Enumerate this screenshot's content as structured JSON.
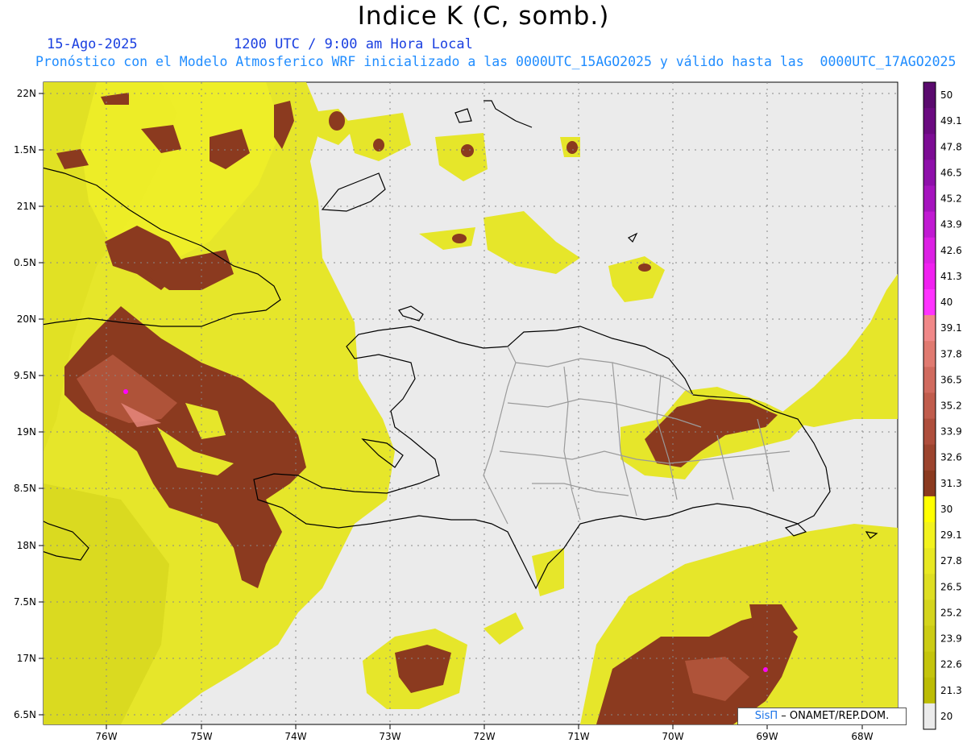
{
  "title": "Indice K (C, somb.)",
  "date_line": "15-Ago-2025",
  "time_line": "1200 UTC / 9:00 am Hora Local",
  "forecast_line": "Pronóstico con el Modelo Atmosferico WRF inicializado a las 0000UTC_15AGO2025 y válido hasta las  0000UTC_17AGO2025",
  "colors": {
    "date_text": "#1a3fe0",
    "forecast_text": "#1f8cff",
    "background": "#ebebeb",
    "yellow_deep": "#c8c800",
    "yellow": "#e6e62a",
    "yellow_bright": "#f5f52a",
    "brown": "#8b3a1f",
    "brown_light": "#b85a40",
    "pink": "#e88a80",
    "magenta": "#ff00ff",
    "coast": "#000000",
    "province": "#9a9a9a"
  },
  "map": {
    "lat_labels": [
      "22N",
      "1.5N",
      "21N",
      "0.5N",
      "20N",
      "9.5N",
      "19N",
      "8.5N",
      "18N",
      "7.5N",
      "17N",
      "6.5N"
    ],
    "lon_labels": [
      "76W",
      "75W",
      "74W",
      "73W",
      "72W",
      "71W",
      "70W",
      "69W",
      "68W"
    ]
  },
  "colorbar": {
    "labels": [
      "50",
      "49.1",
      "47.8",
      "46.5",
      "45.2",
      "43.9",
      "42.6",
      "41.3",
      "40",
      "39.1",
      "37.8",
      "36.5",
      "35.2",
      "33.9",
      "32.6",
      "31.3",
      "30",
      "29.1",
      "27.8",
      "26.5",
      "25.2",
      "23.9",
      "22.6",
      "21.3",
      "20"
    ],
    "colors": [
      "#5a0a6e",
      "#6a0a80",
      "#7c0c94",
      "#8e10aa",
      "#a514be",
      "#c01ad2",
      "#dc20e4",
      "#f020f0",
      "#ff33ff",
      "#f08888",
      "#e07a70",
      "#d06a5e",
      "#c05c4c",
      "#ae4e3c",
      "#9c442e",
      "#8b3a1f",
      "#ffff00",
      "#f2f21e",
      "#e8e822",
      "#dede22",
      "#d4d41c",
      "#cccc14",
      "#c4c40c",
      "#bcbc04",
      "#ebebeb"
    ]
  },
  "credit": {
    "sis": "SisΠ",
    "rest": " – ONAMET/REP.DOM."
  }
}
